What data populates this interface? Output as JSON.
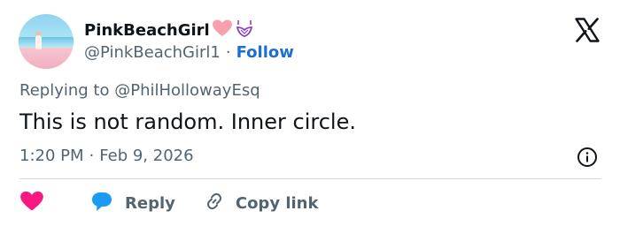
{
  "author": {
    "display_name": "PinkBeachGirl",
    "emojis": [
      "pink-heart-icon",
      "purple-bikini-icon"
    ],
    "handle": "@PinkBeachGirl1",
    "separator": "·",
    "follow_label": "Follow"
  },
  "reply": {
    "prefix": "Replying to",
    "mention": "@PhilHollowayEsq"
  },
  "tweet": {
    "text": "This is not random. Inner circle.",
    "time": "1:20 PM",
    "separator": "·",
    "date": "Feb 9, 2026"
  },
  "actions": {
    "like_icon": "heart-icon",
    "reply_label": "Reply",
    "copy_label": "Copy link"
  },
  "colors": {
    "text": "#0f1419",
    "secondary": "#536471",
    "link": "#1d6fd6",
    "heart": "#f91880",
    "reply_bubble": "#1d9bf0",
    "divider": "#cfd9de"
  }
}
